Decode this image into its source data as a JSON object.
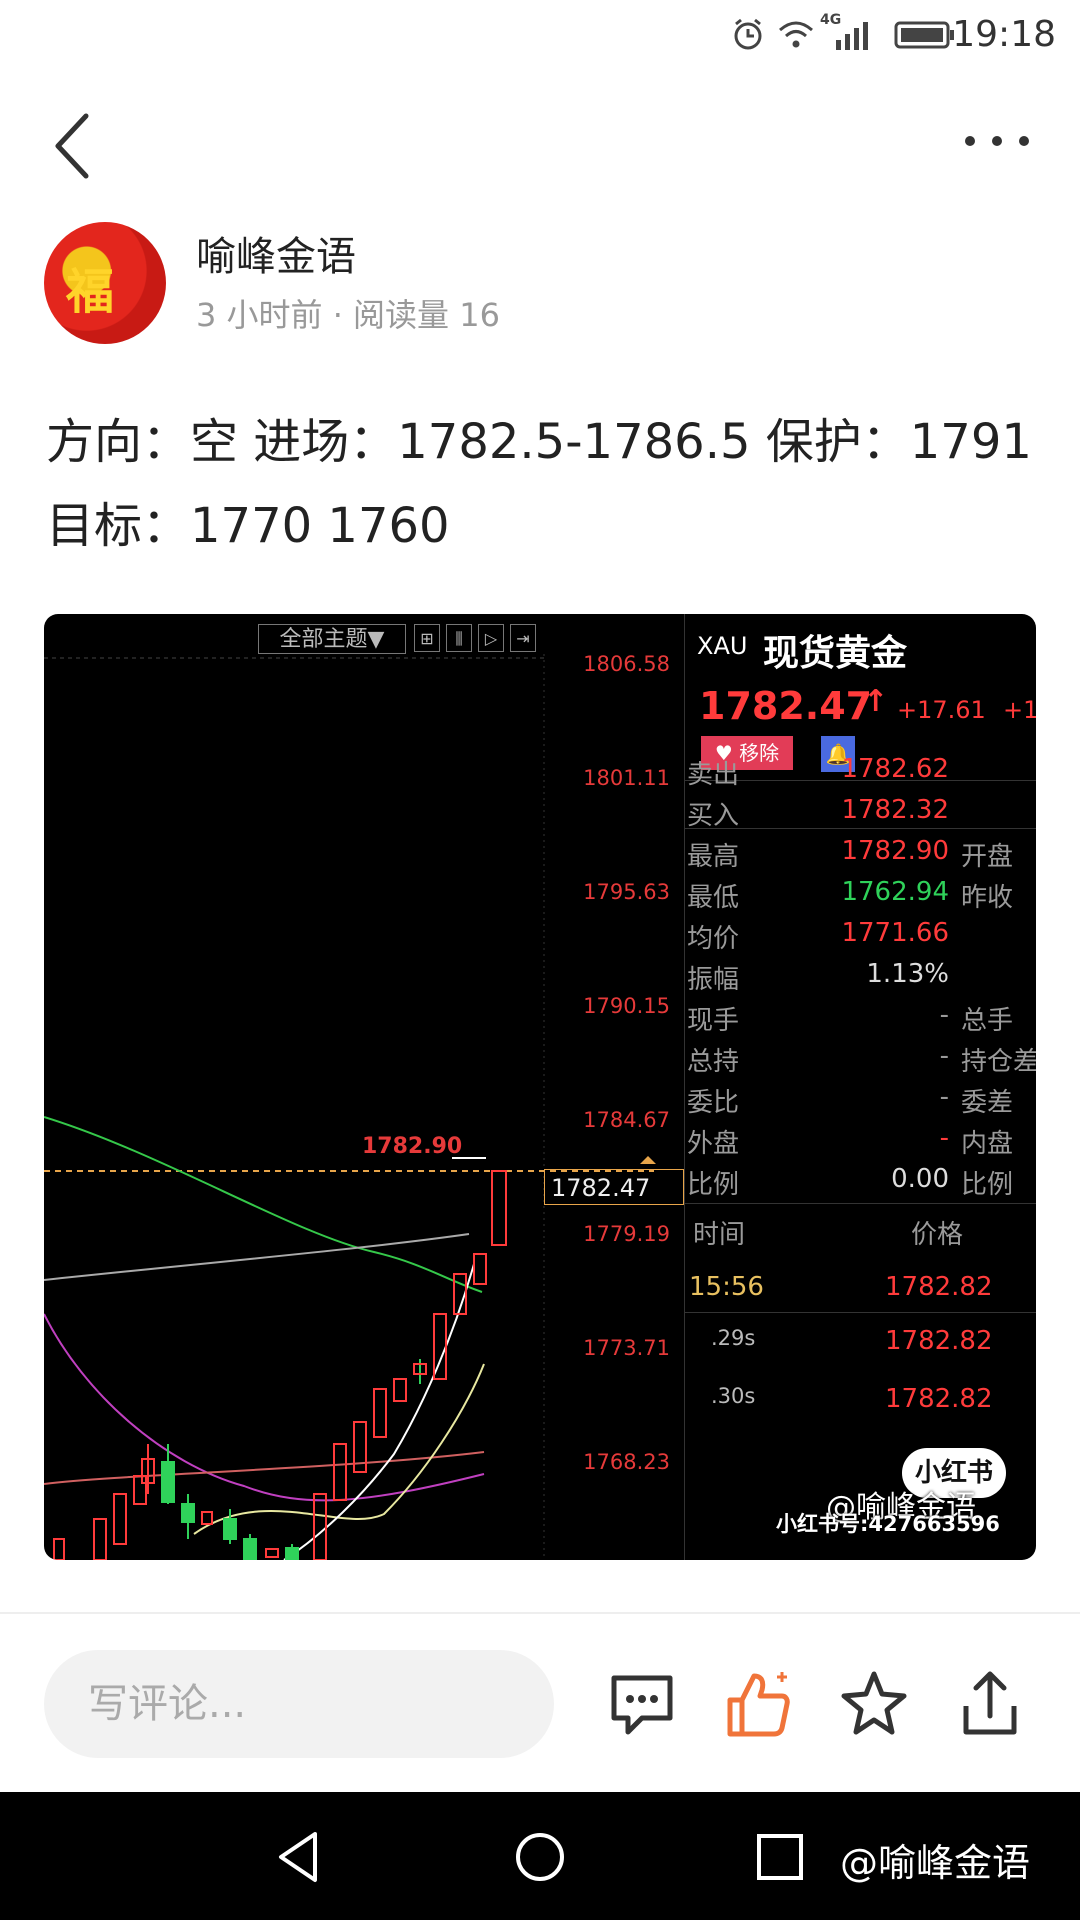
{
  "status_bar": {
    "time": "19:18",
    "network": "4G"
  },
  "author": {
    "name": "喻峰金语",
    "meta": "3 小时前 · 阅读量 16",
    "avatar_char": "福"
  },
  "post": {
    "line1": "方向：空 进场：1782.5-1786.5 保护：1791",
    "line2": "目标：1770 1760"
  },
  "image": {
    "toolbar": {
      "theme_select": "全部主题▼"
    },
    "price_axis": [
      "1806.58",
      "1801.11",
      "1795.63",
      "1790.15",
      "1784.67",
      "1779.19",
      "1773.71",
      "1768.23"
    ],
    "high_label": "1782.90",
    "current_box": "1782.47",
    "quote": {
      "symbol": "XAU",
      "name": "现货黄金",
      "price": "1782.47",
      "arrow": "↑",
      "change": "+17.61",
      "change_pct_partial": "+1",
      "remove_label": "移除",
      "rows": [
        {
          "k": "卖出",
          "v": "1782.62",
          "k2": ""
        },
        {
          "k": "买入",
          "v": "1782.32",
          "k2": ""
        },
        {
          "k": "最高",
          "v": "1782.90",
          "k2": "开盘"
        },
        {
          "k": "最低",
          "v": "1762.94",
          "k2": "昨收"
        },
        {
          "k": "均价",
          "v": "1771.66",
          "k2": ""
        },
        {
          "k": "振幅",
          "v": "1.13%",
          "k2": ""
        },
        {
          "k": "现手",
          "v": "-",
          "k2": "总手"
        },
        {
          "k": "总持",
          "v": "-",
          "k2": "持仓差"
        },
        {
          "k": "委比",
          "v": "-",
          "k2": "委差"
        },
        {
          "k": "外盘",
          "v": "-",
          "k2": "内盘"
        },
        {
          "k": "比例",
          "v": "0.00",
          "k2": "比例"
        }
      ],
      "ticks_header": {
        "time": "时间",
        "price": "价格"
      },
      "ticks": [
        {
          "time": "15:56",
          "price": "1782.82"
        },
        {
          "time": ".29s",
          "price": "1782.82"
        },
        {
          "time": ".30s",
          "price": "1782.82"
        }
      ]
    },
    "watermark": {
      "badge": "小红书",
      "account": "小红书号:427663596",
      "handle": "@喻峰金语"
    }
  },
  "actions": {
    "comment_placeholder": "写评论..."
  },
  "nav_watermark": "@喻峰金语",
  "colors": {
    "up_red": "#ff3b3b",
    "down_green": "#2fd25a",
    "like_orange": "#f0743a"
  }
}
